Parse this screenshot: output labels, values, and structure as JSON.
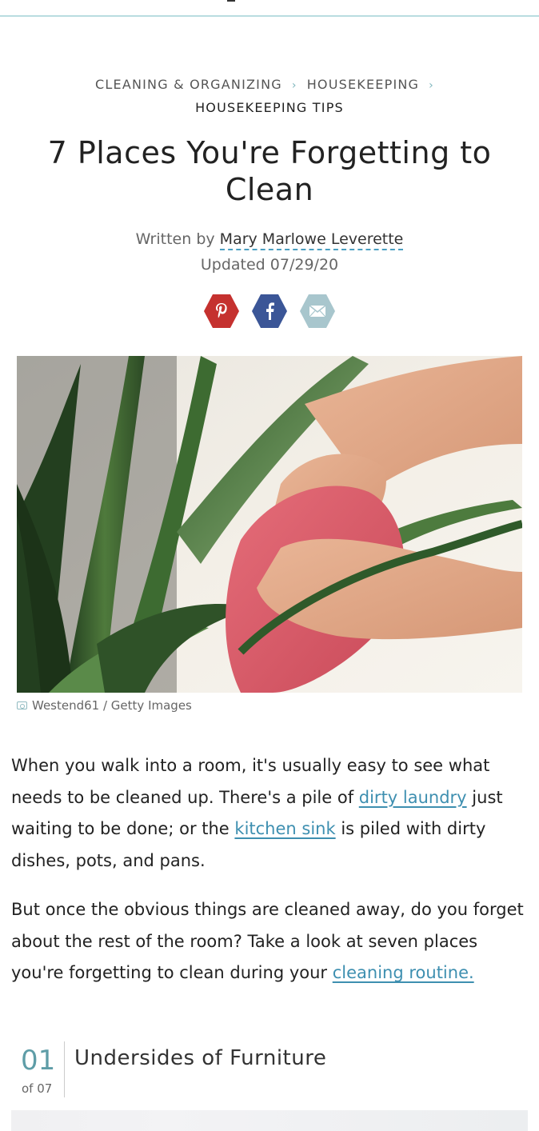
{
  "breadcrumb": {
    "items": [
      "CLEANING & ORGANIZING",
      "HOUSEKEEPING"
    ],
    "current": "HOUSEKEEPING TIPS",
    "separator": "›"
  },
  "article": {
    "title": "7 Places You're Forgetting to Clean",
    "written_by_prefix": "Written by",
    "author": "Mary Marlowe Leverette",
    "updated": "Updated 07/29/20"
  },
  "share": [
    {
      "icon": "pinterest-icon",
      "glyph": "P",
      "color": "#c5312f"
    },
    {
      "icon": "facebook-icon",
      "glyph": "f",
      "color": "#3b5697"
    },
    {
      "icon": "email-icon",
      "glyph": "✉",
      "color": "#a8c6cd"
    }
  ],
  "hero_image": {
    "caption": "Westend61 / Getty Images"
  },
  "paragraph1": {
    "t1": "When you walk into a room, it's usually easy to see what needs to be cleaned up. There's a pile of ",
    "link1": "dirty laundry",
    "t2": " just waiting to be done; or the ",
    "link2": "kitchen sink",
    "t3": " is piled with dirty dishes, pots, and pans."
  },
  "paragraph2": {
    "t1": "But once the obvious things are cleaned away, do you forget about the rest of the room? Take a look at seven places you're forgetting to clean during your ",
    "link1": "cleaning routine."
  },
  "step": {
    "number": "01",
    "of": "of 07",
    "title": "Undersides of Furniture"
  }
}
